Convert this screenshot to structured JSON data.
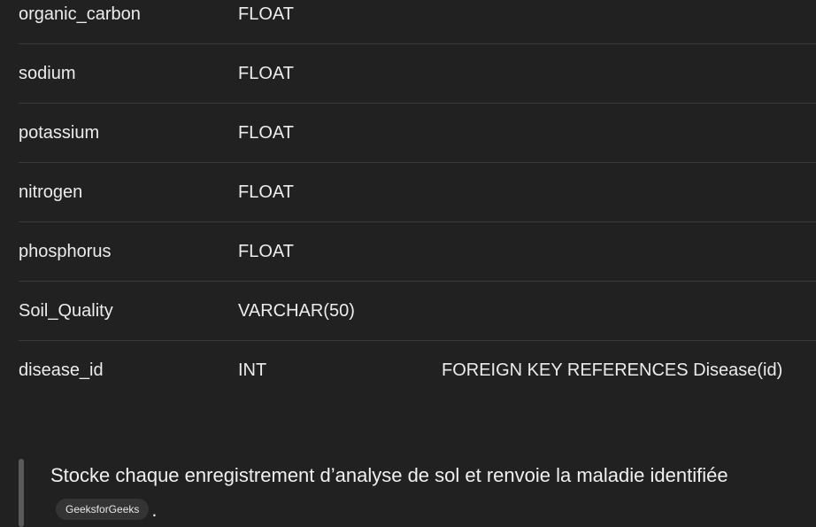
{
  "table": {
    "rows": [
      {
        "name": "organic_carbon",
        "type": "FLOAT",
        "constraint": ""
      },
      {
        "name": "sodium",
        "type": "FLOAT",
        "constraint": ""
      },
      {
        "name": "potassium",
        "type": "FLOAT",
        "constraint": ""
      },
      {
        "name": "nitrogen",
        "type": "FLOAT",
        "constraint": ""
      },
      {
        "name": "phosphorus",
        "type": "FLOAT",
        "constraint": ""
      },
      {
        "name": "Soil_Quality",
        "type": "VARCHAR(50)",
        "constraint": ""
      },
      {
        "name": "disease_id",
        "type": "INT",
        "constraint": "FOREIGN KEY REFERENCES Disease(id)"
      }
    ]
  },
  "quote": {
    "text": "Stocke chaque enregistrement d’analyse de sol et renvoie la maladie identifiée",
    "source_label": "GeeksforGeeks",
    "trailing": "."
  }
}
